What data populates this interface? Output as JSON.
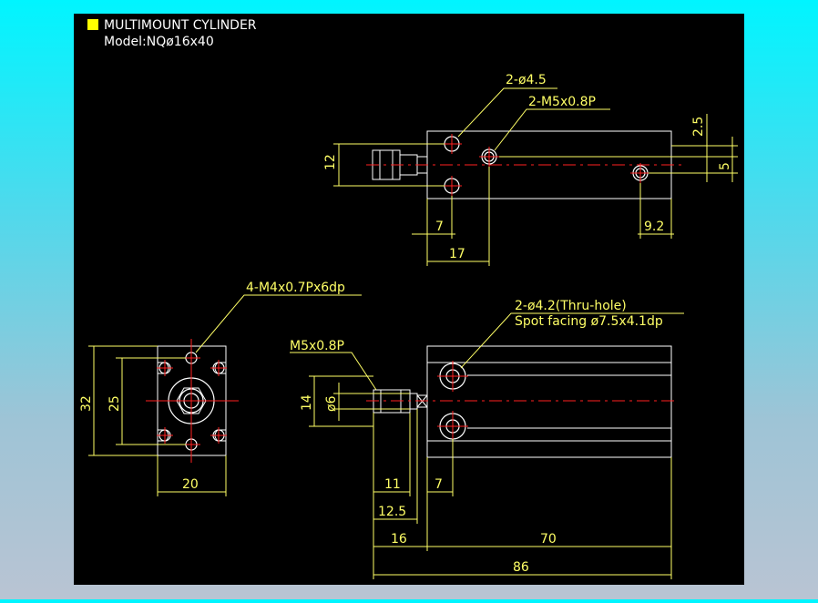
{
  "title": {
    "line1": "MULTIMOUNT CYLINDER",
    "line2": "Model:NQø16x40"
  },
  "colors": {
    "background_top": "#00f5ff",
    "background_bottom": "#b9c4d3",
    "canvas": "#000000",
    "outline": "#ffffff",
    "dimension": "#ffff66",
    "centerline": "#ff2020",
    "title_marker": "#ffff00"
  },
  "top_view": {
    "callouts": {
      "through_holes": "2-ø4.5",
      "ports": "2-M5x0.8P"
    },
    "dims": {
      "height": "12",
      "pos_2_5": "2.5",
      "pos_5": "5",
      "d7": "7",
      "d17": "17",
      "d9_2": "9.2"
    }
  },
  "front_view": {
    "callout": "4-M4x0.7Px6dp",
    "dims": {
      "height_32": "32",
      "height_25": "25",
      "width_20": "20"
    }
  },
  "side_view": {
    "callouts": {
      "holes_line1": "2-ø4.2(Thru-hole)",
      "holes_line2": "Spot facing ø7.5x4.1dp",
      "rod_thread": "M5x0.8P"
    },
    "dims": {
      "d14": "14",
      "d6": "ø6",
      "d11": "11",
      "d7": "7",
      "d12_5": "12.5",
      "d16": "16",
      "d70": "70",
      "d86": "86"
    }
  }
}
